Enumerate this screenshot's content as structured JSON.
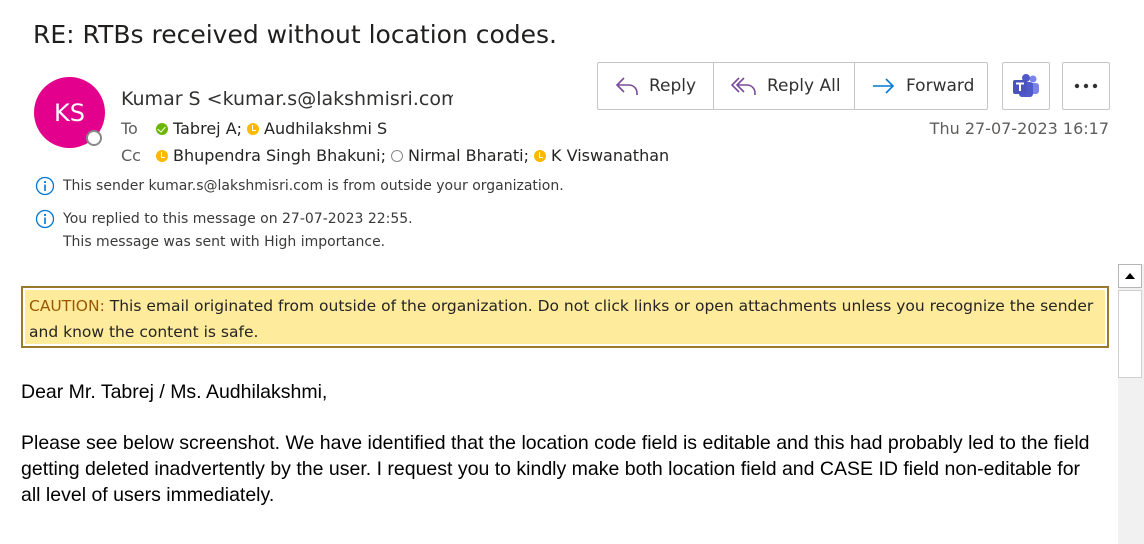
{
  "subject": "RE: RTBs received without location codes.",
  "sender": {
    "initials": "KS",
    "display": "Kumar S <kumar.s@lakshmisri.com>",
    "avatar_color": "#e3008c"
  },
  "to": {
    "label": "To",
    "recipients": [
      {
        "name": "Tabrej A;",
        "status": "available"
      },
      {
        "name": "Audhilakshmi S",
        "status": "away"
      }
    ]
  },
  "cc": {
    "label": "Cc",
    "recipients": [
      {
        "name": "Bhupendra Singh Bhakuni;",
        "status": "away"
      },
      {
        "name": "Nirmal Bharati;",
        "status": "offline"
      },
      {
        "name": "K Viswanathan",
        "status": "away"
      }
    ]
  },
  "date": "Thu 27-07-2023 16:17",
  "actions": {
    "reply": "Reply",
    "reply_all": "Reply All",
    "forward": "Forward",
    "teams_icon": "teams-icon",
    "more_icon": "more-icon"
  },
  "infobar": {
    "external_sender": "This sender kumar.s@lakshmisri.com is from outside your organization.",
    "replied": "You replied to this message on 27-07-2023 22:55.",
    "importance": "This message was sent with High importance."
  },
  "caution": {
    "label": "CAUTION:",
    "text": " This email originated from outside of the organization. Do not click links or open attachments unless you recognize the sender and know the content is safe."
  },
  "body": {
    "greeting": "Dear Mr. Tabrej / Ms. Audhilakshmi,",
    "paragraph": "Please see below screenshot.  We have identified that the location code field is editable and this had probably led to the field getting deleted inadvertently by the user.  I request you to kindly make both location field and CASE ID field non-editable for all level of users immediately."
  },
  "colors": {
    "accent": "#0078d4",
    "caution_bg": "#ffeb9c",
    "caution_border": "#9c7a2c",
    "available": "#6bb700",
    "away": "#fcb900"
  }
}
